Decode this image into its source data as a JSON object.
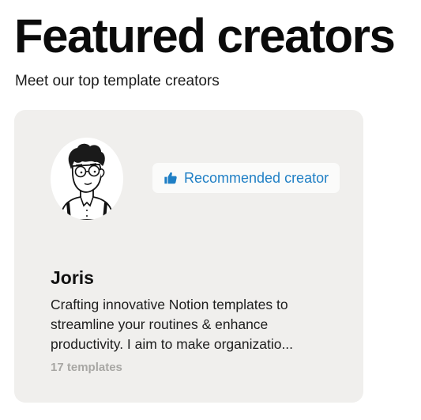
{
  "page": {
    "title": "Featured creators",
    "subtitle": "Meet our top template creators"
  },
  "creator_card": {
    "avatar_icon": "illustrated-person-avatar",
    "badge": {
      "icon": "thumbs-up-icon",
      "label": "Recommended creator",
      "color": "#1f7fc5"
    },
    "name": "Joris",
    "description": "Crafting innovative Notion templates to streamline your routines & enhance productivity. I aim to make organizatio...",
    "template_count": "17 templates",
    "background": "#f0efed"
  }
}
